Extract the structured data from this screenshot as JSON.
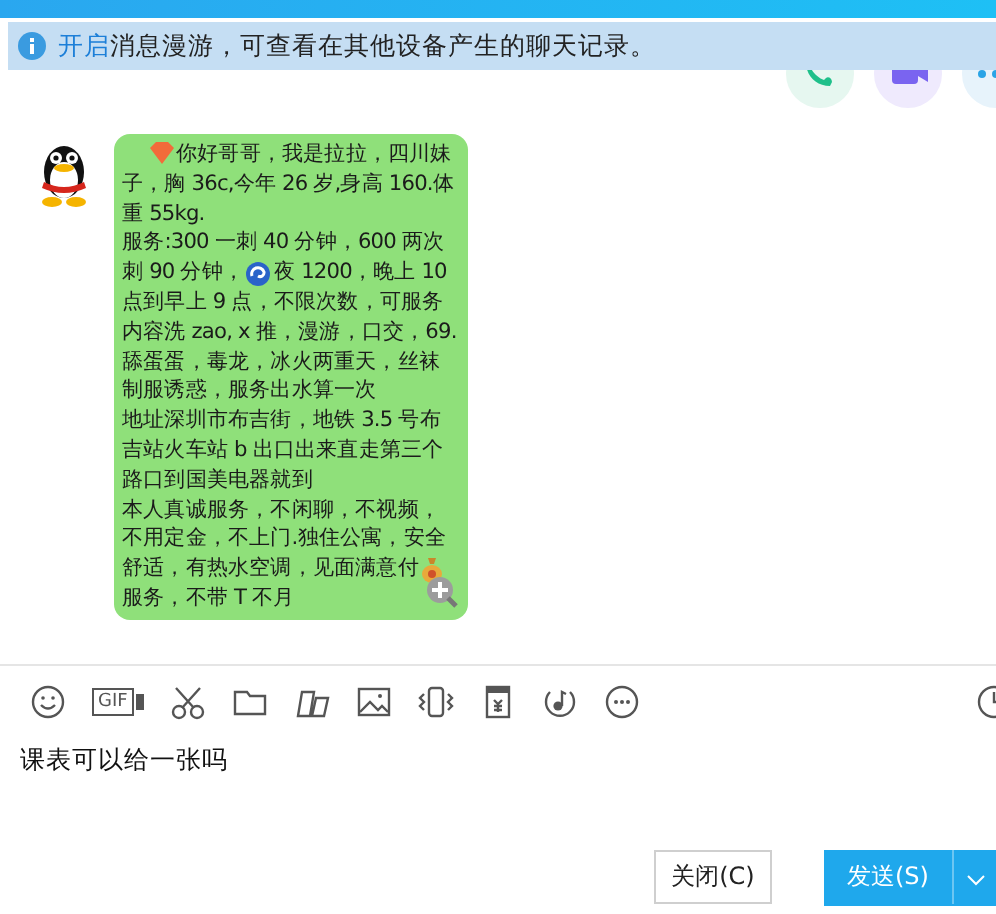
{
  "notice": {
    "link": "开启",
    "text": "消息漫游，可查看在其他设备产生的聊天记录。"
  },
  "header_actions": [
    {
      "kind": "phone"
    },
    {
      "kind": "video"
    },
    {
      "kind": "more"
    }
  ],
  "messages": [
    {
      "lines": [
        [
          {
            "kind": "heart"
          },
          {
            "kind": "text",
            "text": "你好哥哥，我是拉拉，四川妹"
          }
        ],
        [
          {
            "kind": "text",
            "text": "子，胸 36c,今年 26 岁,身高 160.体"
          }
        ],
        [
          {
            "kind": "text",
            "text": "重 55kg."
          }
        ],
        [
          {
            "kind": "text",
            "text": "服务:300 一刺 40 分钟，600 两次"
          }
        ],
        [
          {
            "kind": "text",
            "text": "刺 90 分钟，"
          },
          {
            "kind": "swirl"
          },
          {
            "kind": "text",
            "text": "夜 1200，晚上 10"
          }
        ],
        [
          {
            "kind": "text",
            "text": "点到早上 9 点，不限次数，可服务"
          }
        ],
        [
          {
            "kind": "text",
            "text": "内容洗 zao, x 推，漫游，口交，69."
          }
        ],
        [
          {
            "kind": "text",
            "text": "舔蛋蛋，毒龙，冰火两重天，丝袜"
          }
        ],
        [
          {
            "kind": "text",
            "text": "制服诱惑，服务出水算一次"
          }
        ],
        [
          {
            "kind": "text",
            "text": "地址深圳市布吉街，地铁 3.5 号布"
          }
        ],
        [
          {
            "kind": "text",
            "text": "吉站火车站 b 出口出来直走第三个"
          }
        ],
        [
          {
            "kind": "text",
            "text": "路口到国美电器就到"
          }
        ],
        [
          {
            "kind": "text",
            "text": "本人真诚服务，不闲聊，不视频，"
          }
        ],
        [
          {
            "kind": "text",
            "text": "不用定金，不上门.独住公寓，安全"
          }
        ],
        [
          {
            "kind": "text",
            "text": "舒适，有热水空调，见面满意付"
          },
          {
            "kind": "bag"
          }
        ],
        [
          {
            "kind": "text",
            "text": "服务，不带 T 不月"
          }
        ]
      ]
    }
  ],
  "toolbar": [
    {
      "kind": "emoji"
    },
    {
      "kind": "gif",
      "label": "GIF"
    },
    {
      "kind": "scissors"
    },
    {
      "kind": "folder"
    },
    {
      "kind": "stickers"
    },
    {
      "kind": "image"
    },
    {
      "kind": "shake"
    },
    {
      "kind": "redpacket"
    },
    {
      "kind": "music"
    },
    {
      "kind": "more"
    },
    {
      "kind": "history"
    }
  ],
  "input": {
    "value": "课表可以给一张吗"
  },
  "buttons": [
    {
      "kind": "close",
      "label": "关闭(C)"
    },
    {
      "kind": "send",
      "label": "发送(S)"
    }
  ]
}
